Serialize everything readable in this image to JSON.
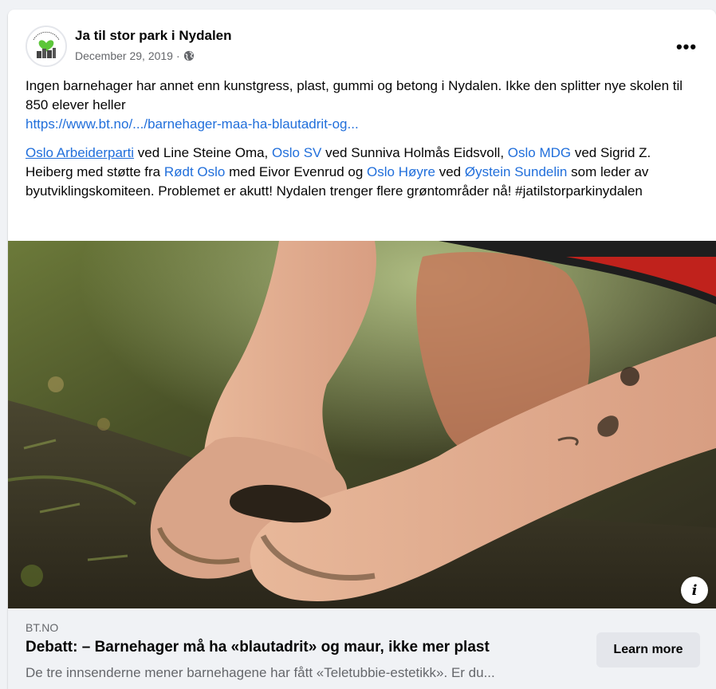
{
  "post": {
    "page_name": "Ja til stor park i Nydalen",
    "date": "December 29, 2019",
    "date_separator": "·",
    "privacy_icon": "globe-icon",
    "more_icon": "more-horizontal-icon",
    "more_label": "•••",
    "avatar_text": "Ja til stor park NYDALEN"
  },
  "body": {
    "paragraph1": "Ingen barnehager har annet enn kunstgress, plast, gummi og betong i Nydalen. Ikke den splitter nye skolen til 850 elever heller",
    "link": "https://www.bt.no/.../barnehager-maa-ha-blautadrit-og...",
    "tags": [
      {
        "text": "Oslo Arbeiderparti",
        "after": " ved Line Steine Oma, "
      },
      {
        "text": "Oslo SV",
        "after": " ved Sunniva Holmås Eidsvoll, "
      },
      {
        "text": "Oslo MDG",
        "after": " ved Sigrid Z. Heiberg med støtte fra "
      },
      {
        "text": "Rødt Oslo",
        "after": " med Eivor Evenrud og "
      },
      {
        "text": "Oslo Høyre",
        "after": " ved "
      },
      {
        "text": "Øystein Sundelin",
        "after": " som leder av byutviklingskomiteen. Problemet er akutt! Nydalen trenger flere grøntområder nå! #jatilstorparkinydalen"
      }
    ]
  },
  "preview": {
    "domain": "BT.NO",
    "headline": "Debatt: – Barnehager må ha «blautadrit» og maur, ikke mer plast",
    "description": "De tre innsenderne mener barnehagene har fått «Teletubbie-estetikk». Er du...",
    "cta": "Learn more",
    "info_label": "i"
  },
  "colors": {
    "link": "#216fdb",
    "secondary_text": "#65676b",
    "preview_bg": "#f0f2f5",
    "button_bg": "#e4e6eb"
  }
}
